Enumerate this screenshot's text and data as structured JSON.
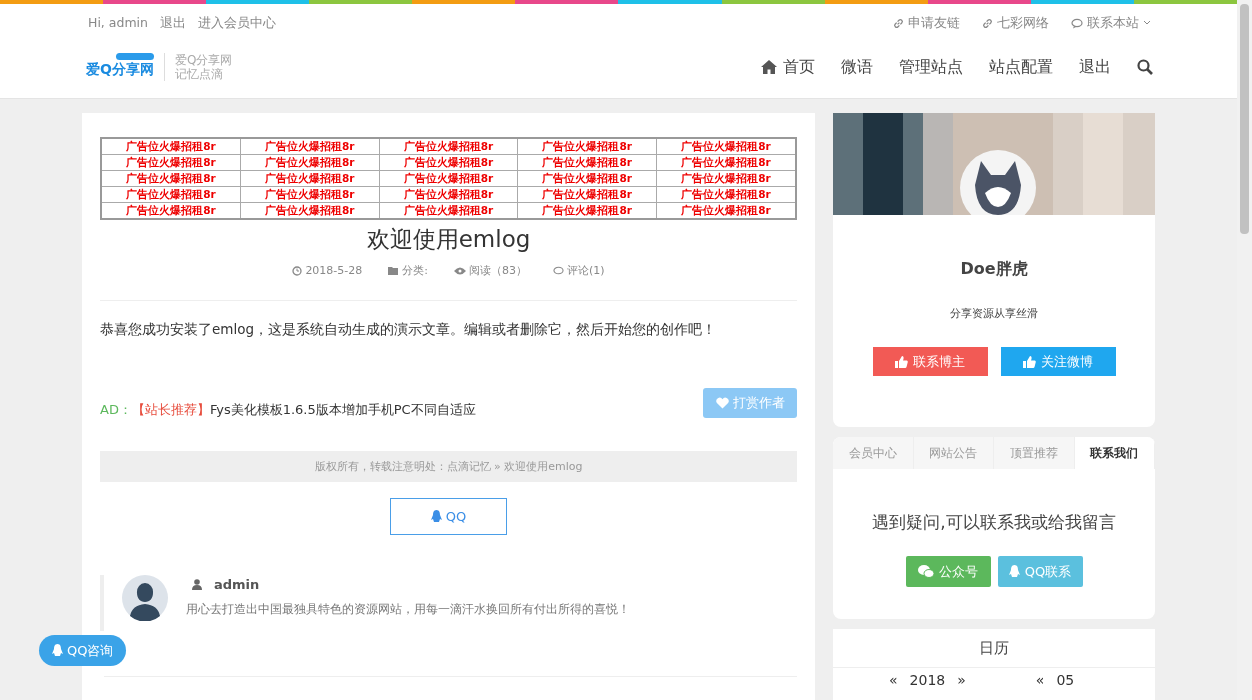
{
  "topbar": {
    "greeting": "Hi, admin",
    "logout": "退出",
    "member_center": "进入会员中心",
    "links": [
      {
        "kind": "link",
        "label": "申请友链",
        "dropdown": false
      },
      {
        "kind": "link",
        "label": "七彩网络",
        "dropdown": false
      },
      {
        "kind": "chat",
        "label": "联系本站",
        "dropdown": true
      }
    ]
  },
  "header": {
    "logo": "爱Q分享网",
    "site_name": "爱Q分享网",
    "slogan": "记忆点滴",
    "nav": [
      {
        "label": "首页",
        "kind": "home"
      },
      {
        "label": "微语",
        "kind": "text"
      },
      {
        "label": "管理站点",
        "kind": "text"
      },
      {
        "label": "站点配置",
        "kind": "text"
      },
      {
        "label": "退出",
        "kind": "text"
      }
    ]
  },
  "ad_grid": [
    [
      "广告位火爆招租8r",
      "广告位火爆招租8r",
      "广告位火爆招租8r",
      "广告位火爆招租8r",
      "广告位火爆招租8r"
    ],
    [
      "广告位火爆招租8r",
      "广告位火爆招租8r",
      "广告位火爆招租8r",
      "广告位火爆招租8r",
      "广告位火爆招租8r"
    ],
    [
      "广告位火爆招租8r",
      "广告位火爆招租8r",
      "广告位火爆招租8r",
      "广告位火爆招租8r",
      "广告位火爆招租8r"
    ],
    [
      "广告位火爆招租8r",
      "广告位火爆招租8r",
      "广告位火爆招租8r",
      "广告位火爆招租8r",
      "广告位火爆招租8r"
    ],
    [
      "广告位火爆招租8r",
      "广告位火爆招租8r",
      "广告位火爆招租8r",
      "广告位火爆招租8r",
      "广告位火爆招租8r"
    ]
  ],
  "post": {
    "title": "欢迎使用emlog",
    "meta": [
      {
        "kind": "date",
        "text": "2018-5-28"
      },
      {
        "kind": "category",
        "text": "分类:"
      },
      {
        "kind": "views",
        "text": "阅读（83）"
      },
      {
        "kind": "comments",
        "text": "评论(1)"
      }
    ],
    "body": "恭喜您成功安装了emlog，这是系统自动生成的演示文章。编辑或者删除它，然后开始您的创作吧！",
    "ad_label": "AD：",
    "ad_tag": "【站长推荐】",
    "ad_text": "Fys美化模板1.6.5版本增加手机PC不同自适应",
    "reward_button": "打赏作者",
    "copyright": "版权所有，转载注意明处：点滴记忆 » 欢迎使用emlog",
    "qq_button": "QQ",
    "author": {
      "name": "admin",
      "bio": "用心去打造出中国最独具特色的资源网站，用每一滴汗水换回所有付出所得的喜悦！"
    }
  },
  "float_button": "QQ咨询",
  "profile": {
    "name": "Doe胖虎",
    "motto": "分享资源从享丝滑",
    "buttons": [
      {
        "label": "联系博主",
        "color": "#f25a55"
      },
      {
        "label": "关注微博",
        "color": "#1fa7ef"
      }
    ]
  },
  "tabs": [
    {
      "label": "会员中心",
      "selected": false
    },
    {
      "label": "网站公告",
      "selected": false
    },
    {
      "label": "顶置推荐",
      "selected": false
    },
    {
      "label": "联系我们",
      "selected": true
    }
  ],
  "contact": {
    "text": "遇到疑问,可以联系我或给我留言",
    "buttons": [
      {
        "kind": "wechat",
        "label": "公众号",
        "color": "#5cb85c"
      },
      {
        "kind": "qq",
        "label": "QQ联系",
        "color": "#5bc0de"
      }
    ]
  },
  "calendar": {
    "title": "日历",
    "year_prev": "«",
    "year": "2018",
    "year_next": "»",
    "month_prev": "«",
    "month": "05"
  }
}
